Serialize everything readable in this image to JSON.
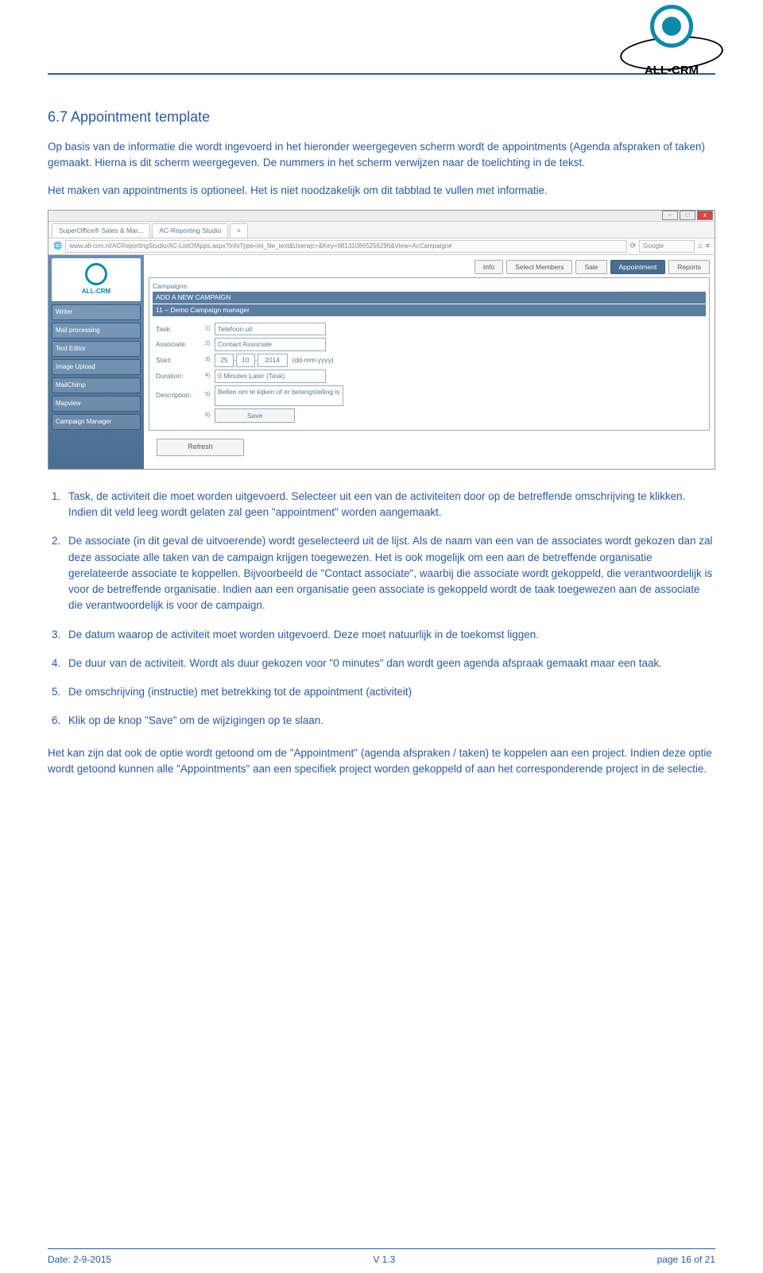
{
  "header": {
    "brand": "ALL-CRM"
  },
  "title": "6.7 Appointment template",
  "intro": "Op basis van de informatie die wordt ingevoerd in het hieronder weergegeven scherm wordt de appointments (Agenda afspraken of taken) gemaakt. Hierna is dit scherm weergegeven. De nummers in het scherm verwijzen naar de toelichting in de tekst.",
  "intro2": "Het maken van appointments is optioneel. Het is niet noodzakelijk om dit tabblad te vullen met informatie.",
  "screenshot": {
    "tab1": "SuperOffice® Sales & Mar...",
    "tab2": "AC-Reporting Studio",
    "url": "www.all-crm.nl/ACReportingStudio/AC-ListOfApps.aspx?InfoType=ini_file_text&Userajc=&Key=981310865256296&View=AcCampaign#",
    "search_placeholder": "Google",
    "sidebar": {
      "brand": "ALL-CRM",
      "items": [
        "Writer",
        "Mail processing",
        "Text Editor",
        "Image Upload",
        "MailChimp",
        "Mapview",
        "Campaign Manager"
      ]
    },
    "nav": [
      "Info",
      "Select Members",
      "Sale",
      "Appointment",
      "Reports"
    ],
    "campaigns_label": "Campaigns:",
    "campaigns": [
      "ADD A NEW CAMPAIGN",
      "11 – Demo Campaign manager"
    ],
    "form": {
      "task_label": "Task:",
      "task_value": "Telefoon uit",
      "associate_label": "Associate:",
      "associate_value": "Contact Associate",
      "start_label": "Start:",
      "start_d": "25",
      "start_m": "10",
      "start_y": "2014",
      "start_hint": "(dd-mm-yyyy)",
      "duration_label": "Duration:",
      "duration_value": "0 Minutes Later (Task)",
      "desc_label": "Description:",
      "desc_value": "Bellen om te kijken of er belangstelling is",
      "save": "Save"
    },
    "refresh": "Refresh"
  },
  "list": {
    "i1": "Task, de activiteit die moet worden uitgevoerd. Selecteer uit een van de activiteiten door op de betreffende omschrijving te klikken. Indien dit veld leeg wordt gelaten zal geen \"appointment\" worden aangemaakt.",
    "i2": "De associate (in dit geval de uitvoerende) wordt geselecteerd uit de lijst. Als de naam van een van de associates wordt gekozen dan zal deze associate alle taken van de campaign krijgen toegewezen. Het is ook mogelijk om een aan de betreffende organisatie gerelateerde associate te koppellen. Bijvoorbeeld de \"Contact associate\", waarbij die associate wordt gekoppeld, die verantwoordelijk is voor de betreffende organisatie. Indien aan een organisatie geen associate is gekoppeld wordt de taak toegewezen aan de associate die verantwoordelijk is voor de campaign.",
    "i3": "De datum waarop de activiteit moet worden uitgevoerd. Deze moet natuurlijk in de toekomst liggen.",
    "i4": "De duur van de activiteit. Wordt als duur gekozen voor \"0 minutes\" dan wordt geen agenda afspraak gemaakt maar een taak.",
    "i5": "De omschrijving (instructie) met betrekking tot de appointment (activiteit)",
    "i6": "Klik op de knop \"Save\" om de wijzigingen op te slaan."
  },
  "closing": "Het kan zijn dat ook de optie wordt getoond om de \"Appointment\" (agenda afspraken / taken) te koppelen aan een project. Indien deze optie wordt getoond kunnen alle \"Appointments\" aan een specifiek project worden gekoppeld of aan het corresponderende project in de selectie.",
  "footer": {
    "date": "Date: 2-9-2015",
    "version": "V 1.3",
    "page": "page 16 of 21"
  }
}
